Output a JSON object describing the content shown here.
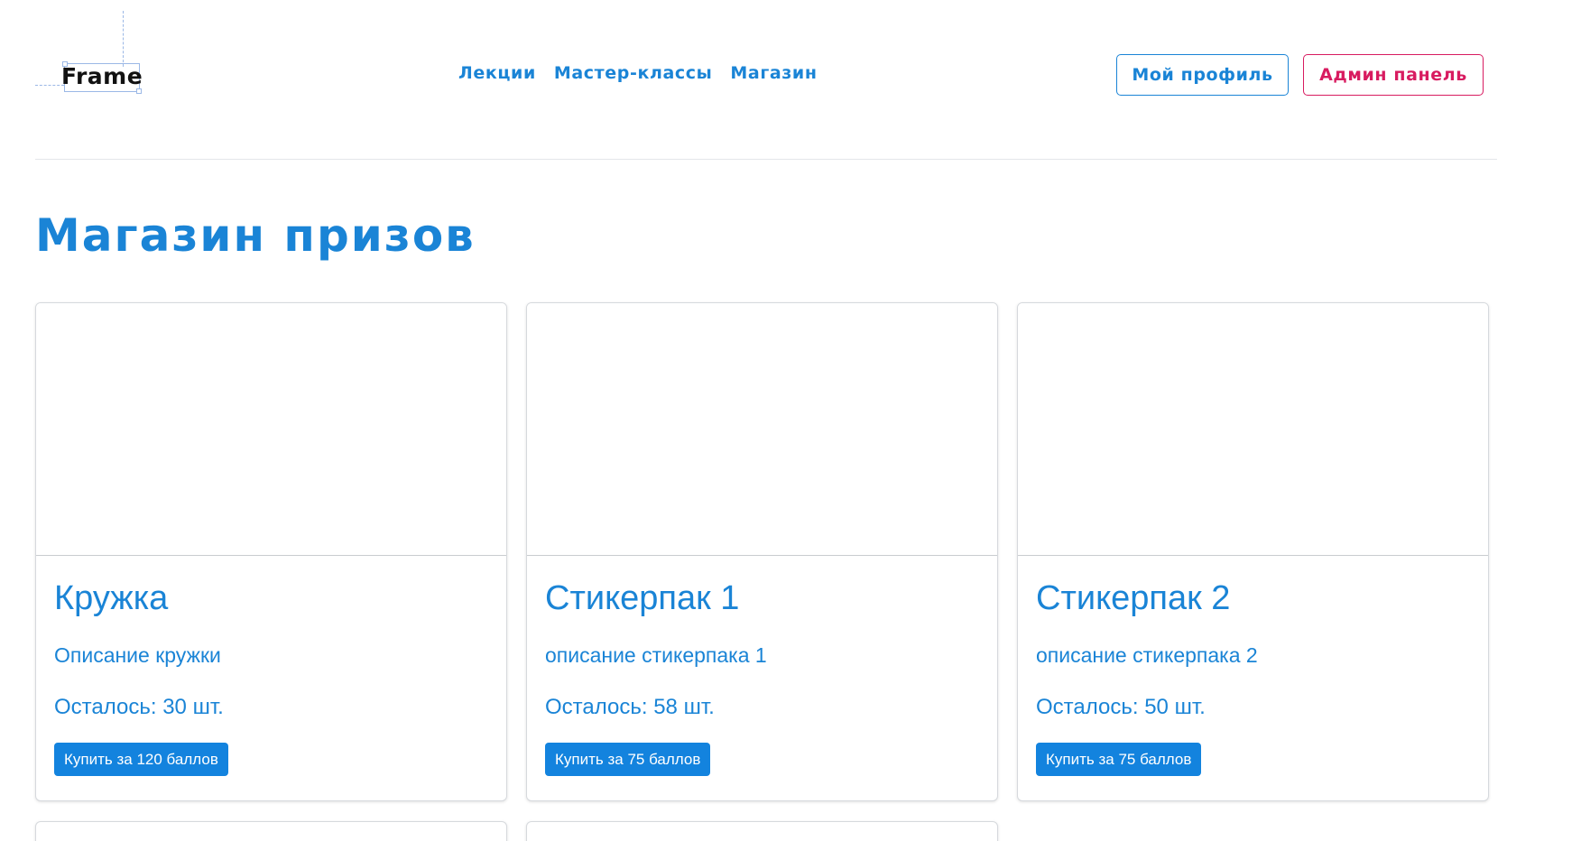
{
  "header": {
    "logo_text": "Frame",
    "nav": [
      "Лекции",
      "Мастер-классы",
      "Магазин"
    ],
    "profile_button": "Мой профиль",
    "admin_button": "Админ панель"
  },
  "main": {
    "title": "Магазин призов",
    "products": [
      {
        "name": "Кружка",
        "description": "Описание кружки",
        "stock": "Осталось: 30 шт.",
        "buy_label": "Купить за 120 баллов"
      },
      {
        "name": "Стикерпак 1",
        "description": "описание стикерпака 1",
        "stock": "Осталось: 58 шт.",
        "buy_label": "Купить за 75 баллов"
      },
      {
        "name": "Стикерпак 2",
        "description": "описание стикерпака 2",
        "stock": "Осталось: 50 шт.",
        "buy_label": "Купить за 75 баллов"
      }
    ]
  },
  "colors": {
    "accent": "#1a84d6",
    "button_bg": "#1383de",
    "admin": "#d81b60"
  }
}
